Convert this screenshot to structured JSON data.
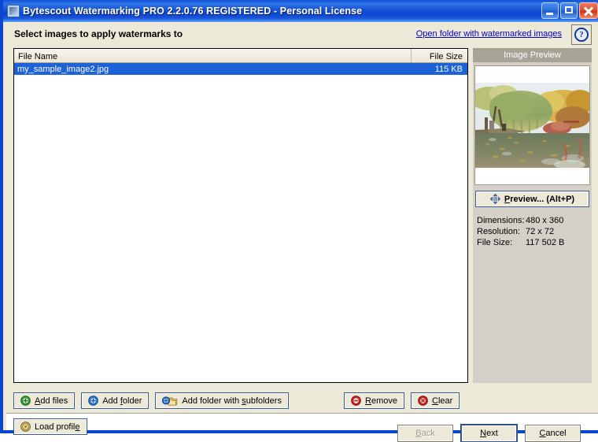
{
  "window": {
    "title": "Bytescout Watermarking PRO 2.2.0.76 REGISTERED - Personal License",
    "app_icon": "app-image-icon",
    "minimize_label": "Minimize",
    "maximize_label": "Maximize",
    "close_label": "Close"
  },
  "header": {
    "page_title": "Select images to apply watermarks to",
    "open_folder_link": "Open folder with watermarked images",
    "help_glyph": "?"
  },
  "file_list": {
    "columns": [
      "File Name",
      "File Size"
    ],
    "rows": [
      {
        "name": "my_sample_image2.jpg",
        "size": "115 KB",
        "selected": true
      }
    ]
  },
  "preview": {
    "panel_title": "Image Preview",
    "preview_button_pre": "",
    "preview_button_label": "Preview... (Alt+P)",
    "preview_button_accel": "P",
    "info": [
      {
        "key": "Dimensions:",
        "value": "480 x 360"
      },
      {
        "key": "Resolution:",
        "value": "72 x 72"
      },
      {
        "key": "File Size:",
        "value": "117 502 B"
      }
    ]
  },
  "toolbar": {
    "add_files_label": "Add files",
    "add_folder_label": "Add folder",
    "add_folder_subfolders_label": "Add folder with subfolders",
    "remove_label": "Remove",
    "clear_label": "Clear",
    "load_profile_label": "Load profile"
  },
  "nav": {
    "back_label": "Back",
    "next_label": "Next",
    "cancel_label": "Cancel",
    "back_enabled": false,
    "next_is_default": true
  },
  "colors": {
    "titlebar_blue": "#0a46d2",
    "window_face": "#ece9d8",
    "selection_blue": "#1d62d6",
    "panel_gray": "#d4d0c8",
    "panel_header_gray": "#a8a495",
    "link_blue": "#0000c0"
  }
}
